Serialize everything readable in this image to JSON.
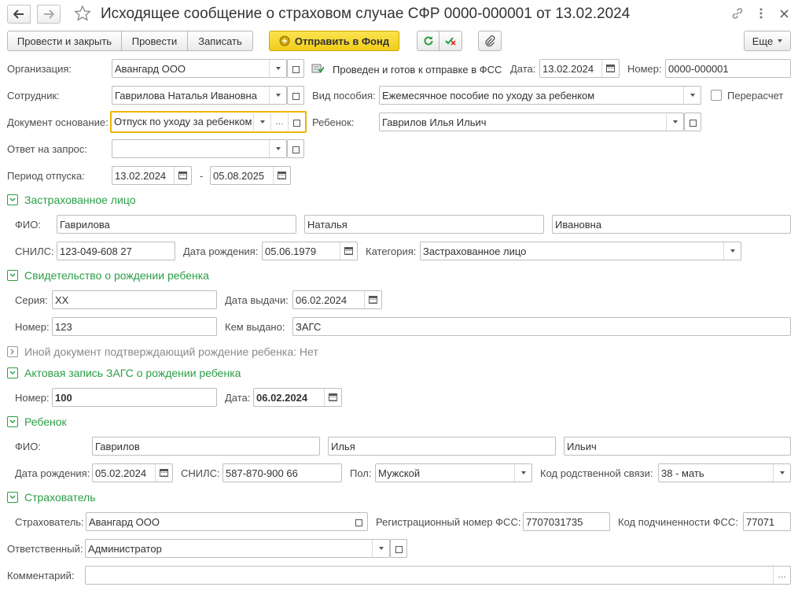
{
  "title": "Исходящее сообщение о страховом случае СФР 0000-000001 от 13.02.2024",
  "toolbar": {
    "post_close": "Провести и закрыть",
    "post": "Провести",
    "save": "Записать",
    "send": "Отправить в Фонд",
    "more": "Еще"
  },
  "org": {
    "label": "Организация:",
    "value": "Авангард ООО"
  },
  "employee": {
    "label": "Сотрудник:",
    "value": "Гаврилова Наталья Ивановна"
  },
  "basis": {
    "label": "Документ основание:",
    "value": "Отпуск по уходу за ребенком"
  },
  "reply": {
    "label": "Ответ на запрос:",
    "value": ""
  },
  "period": {
    "label": "Период отпуска:",
    "from": "13.02.2024",
    "dash": "-",
    "to": "05.08.2025"
  },
  "status": {
    "text": "Проведен и готов к отправке в ФСС"
  },
  "date": {
    "label": "Дата:",
    "value": "13.02.2024"
  },
  "number": {
    "label": "Номер:",
    "value": "0000-000001"
  },
  "benefit": {
    "label": "Вид пособия:",
    "value": "Ежемесячное пособие по уходу за ребенком"
  },
  "recalc": {
    "label": "Перерасчет",
    "checked": false
  },
  "child_ref": {
    "label": "Ребенок:",
    "value": "Гаврилов Илья Ильич"
  },
  "insured": {
    "title": "Застрахованное лицо",
    "fio_label": "ФИО:",
    "last": "Гаврилова",
    "first": "Наталья",
    "middle": "Ивановна",
    "snils_label": "СНИЛС:",
    "snils": "123-049-608 27",
    "dob_label": "Дата рождения:",
    "dob": "05.06.1979",
    "cat_label": "Категория:",
    "category": "Застрахованное лицо"
  },
  "cert": {
    "title": "Свидетельство о рождении ребенка",
    "series_label": "Серия:",
    "series": "XX",
    "issue_label": "Дата выдачи:",
    "issue": "06.02.2024",
    "num_label": "Номер:",
    "num": "123",
    "by_label": "Кем выдано:",
    "by": "ЗАГС"
  },
  "other_doc": {
    "title": "Иной документ подтверждающий рождение ребенка: Нет"
  },
  "zags": {
    "title": "Актовая запись ЗАГС о рождении ребенка",
    "num_label": "Номер:",
    "num": "100",
    "date_label": "Дата:",
    "date": "06.02.2024"
  },
  "child": {
    "title": "Ребенок",
    "fio_label": "ФИО:",
    "last": "Гаврилов",
    "first": "Илья",
    "middle": "Ильич",
    "dob_label": "Дата рождения:",
    "dob": "05.02.2024",
    "snils_label": "СНИЛС:",
    "snils": "587-870-900 66",
    "sex_label": "Пол:",
    "sex": "Мужской",
    "rel_label": "Код родственной связи:",
    "rel": "38 - мать"
  },
  "insurer": {
    "title": "Страхователь",
    "ins_label": "Страхователь:",
    "ins": "Авангард ООО",
    "reg_label": "Регистрационный номер ФСС:",
    "reg": "7707031735",
    "sub_label": "Код подчиненности ФСС:",
    "sub": "77071"
  },
  "resp": {
    "label": "Ответственный:",
    "value": "Администратор"
  },
  "comment": {
    "label": "Комментарий:",
    "value": ""
  },
  "colors": {
    "accent_green": "#2a9e45",
    "send_button": "#f5d52b",
    "focus_border": "#f0b400"
  }
}
